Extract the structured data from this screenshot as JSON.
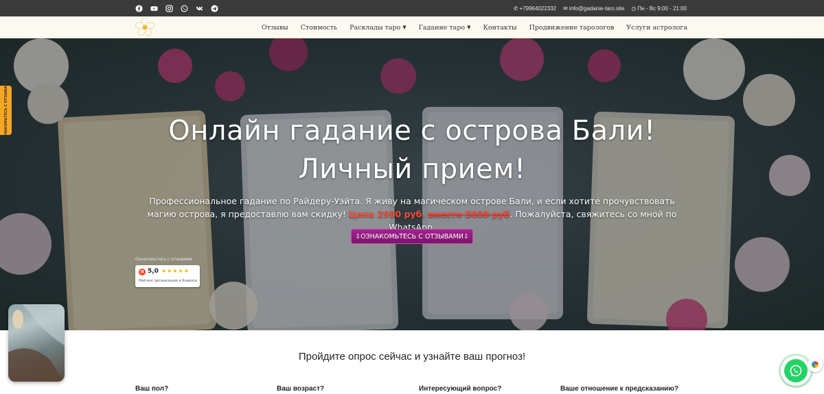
{
  "topbar": {
    "social_icons": [
      "facebook-icon",
      "youtube-icon",
      "instagram-icon",
      "whatsapp-icon",
      "vk-icon",
      "telegram-icon"
    ],
    "phone": "+79964022332",
    "email": "info@gadanie-taro.site",
    "hours": "Пн - Вс 9:00 - 21:00"
  },
  "nav": {
    "items": [
      {
        "label": "Отзывы",
        "dropdown": false
      },
      {
        "label": "Стоимость",
        "dropdown": false
      },
      {
        "label": "Расклады таро",
        "dropdown": true
      },
      {
        "label": "Гадание таро",
        "dropdown": true
      },
      {
        "label": "Контакты",
        "dropdown": false
      },
      {
        "label": "Продвижение тарологов",
        "dropdown": false
      },
      {
        "label": "Услуги астролога",
        "dropdown": false
      }
    ]
  },
  "hero": {
    "title_line1": "Онлайн гадание с острова Бали!",
    "title_line2": "Личный прием!",
    "desc_part1": "Профессиональное гадание по Райдеру-Уэйта. Я живу на магическом острове Бали, и если хотите прочувствовать магию острова, я предоставлю вам скидку!",
    "price": "Цена 2900 руб.",
    "old_price": "вместо 5000 руб",
    "desc_part2": ". Пожалуйста, свяжитесь со мной по WhatsApp.",
    "cta_label": "⇩ОЗНАКОМЬТЕСЬ С ОТЗЫВАМИ⇩",
    "reviews_label": "Ознакомьтесь с отзывами",
    "rating": "5,0",
    "rating_stars": "★★★★★",
    "rating_sub": "Рейтинг организации в Яндексе",
    "yandex_letter": "Я"
  },
  "side_tab": {
    "label": "ОЗНАКОМЬТЕСЬ С ОТЗЫВАМИ"
  },
  "quiz": {
    "title": "Пройдите опрос сейчас и узнайте ваш прогноз!",
    "questions": [
      "Ваш пол?",
      "Ваш возраст?",
      "Интересующий вопрос?",
      "Ваше отношение к предсказанию?"
    ]
  },
  "colors": {
    "topbar_bg": "#3a3a3a",
    "nav_bg": "#fbf9f0",
    "cta_bg": "#8e1c7c",
    "price_red": "#ff4d3a",
    "whatsapp_green": "#25d366",
    "side_tab_orange": "#f5a623"
  }
}
